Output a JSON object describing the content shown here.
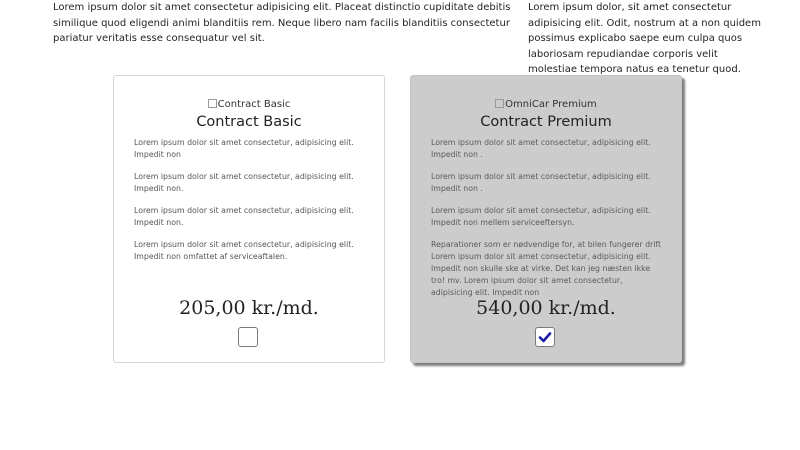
{
  "intro": {
    "left_text": "Lorem ipsum dolor sit amet consectetur adipisicing elit. Placeat distinctio cupiditate debitis similique quod eligendi animi blanditiis rem. Neque libero nam facilis blanditiis consectetur pariatur veritatis esse consequatur vel sit.",
    "right_text": "Lorem ipsum dolor, sit amet consectetur adipisicing elit. Odit, nostrum at a non quidem possimus explicabo saepe eum culpa quos laboriosam repudiandae corporis velit molestiae tempora natus ea tenetur quod."
  },
  "plans": [
    {
      "image_alt": "Contract Basic",
      "title": "Contract Basic",
      "features": [
        "Lorem ipsum dolor sit amet consectetur, adipisicing elit. Impedit non",
        "Lorem ipsum dolor sit amet consectetur, adipisicing elit. Impedit non.",
        "Lorem ipsum dolor sit amet consectetur, adipisicing elit. Impedit non.",
        "Lorem ipsum dolor sit amet consectetur, adipisicing elit. Impedit non omfattet af serviceaftalen."
      ],
      "price": "205,00 kr./md.",
      "selected": false
    },
    {
      "image_alt": "OmniCar Premium",
      "title": "Contract Premium",
      "features": [
        "Lorem ipsum dolor sit amet consectetur, adipisicing elit. Impedit non .",
        "Lorem ipsum dolor sit amet consectetur, adipisicing elit. Impedit non .",
        "Lorem ipsum dolor sit amet consectetur, adipisicing elit. Impedit non mellem serviceeftersyn.",
        "Reparationer som er nødvendige for, at bilen fungerer drift Lorem ipsum dolor sit amet consectetur, adipisicing elit. Impedit non skulle ske at virke. Det kan jeg næsten ikke tro! mv. Lorem ipsum dolor sit amet consectetur, adipisicing elit. Impedit non"
      ],
      "price": "540,00 kr./md.",
      "selected": true
    }
  ],
  "colors": {
    "check_mark": "#1a1aa6",
    "premium_bg": "#cccccc"
  }
}
